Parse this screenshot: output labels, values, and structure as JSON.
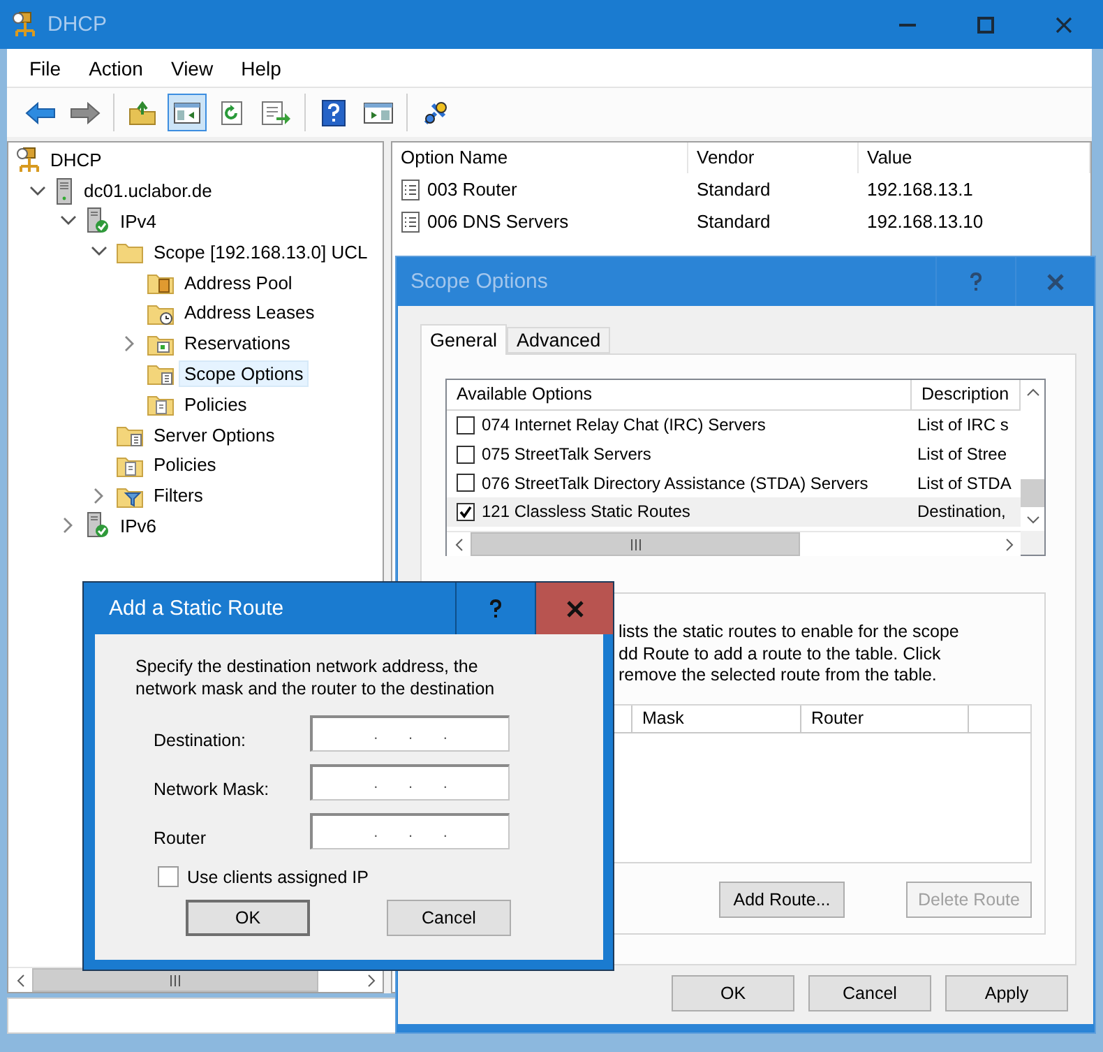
{
  "window": {
    "title": "DHCP"
  },
  "menu": [
    {
      "label": "File"
    },
    {
      "label": "Action"
    },
    {
      "label": "View"
    },
    {
      "label": "Help"
    }
  ],
  "toolbar": [
    [
      {
        "kind": "back",
        "pressed": false
      },
      {
        "kind": "forward",
        "pressed": false
      }
    ],
    [
      {
        "kind": "up",
        "pressed": false
      },
      {
        "kind": "console",
        "pressed": true
      },
      {
        "kind": "refresh",
        "pressed": false
      },
      {
        "kind": "export",
        "pressed": false
      }
    ],
    [
      {
        "kind": "help",
        "pressed": false
      },
      {
        "kind": "pane",
        "pressed": false
      }
    ],
    [
      {
        "kind": "tool",
        "pressed": false
      }
    ]
  ],
  "tree": [
    {
      "label": "DHCP",
      "kind": "root",
      "selected": false,
      "children": [
        {
          "label": "dc01.uclabor.de",
          "kind": "server",
          "expanded": true,
          "selected": false,
          "children": [
            {
              "label": "IPv4",
              "kind": "protocol",
              "expanded": true,
              "selected": false,
              "children": [
                {
                  "label": "Scope [192.168.13.0] UCL",
                  "kind": "folder",
                  "expanded": true,
                  "selected": false,
                  "children": [
                    {
                      "label": "Address Pool",
                      "kind": "pool",
                      "selected": false
                    },
                    {
                      "label": "Address Leases",
                      "kind": "leases",
                      "selected": false
                    },
                    {
                      "label": "Reservations",
                      "kind": "reservations",
                      "expanded": false,
                      "selected": false
                    },
                    {
                      "label": "Scope Options",
                      "kind": "options",
                      "selected": true
                    },
                    {
                      "label": "Policies",
                      "kind": "policies",
                      "selected": false
                    }
                  ]
                },
                {
                  "label": "Server Options",
                  "kind": "options",
                  "selected": false
                },
                {
                  "label": "Policies",
                  "kind": "policies",
                  "selected": false
                },
                {
                  "label": "Filters",
                  "kind": "filters",
                  "expanded": false,
                  "selected": false
                }
              ]
            },
            {
              "label": "IPv6",
              "kind": "protocol",
              "expanded": false,
              "selected": false
            }
          ]
        }
      ]
    }
  ],
  "options_table": {
    "columns": [
      "Option Name",
      "Vendor",
      "Value"
    ],
    "rows": [
      {
        "cells": [
          "003 Router",
          "Standard",
          "192.168.13.1"
        ]
      },
      {
        "cells": [
          "006 DNS Servers",
          "Standard",
          "192.168.13.10"
        ]
      }
    ]
  },
  "scope_dialog": {
    "title": "Scope Options",
    "active": false,
    "tabs": [
      {
        "label": "General",
        "selected": true
      },
      {
        "label": "Advanced",
        "selected": false
      }
    ],
    "options_list": {
      "columns": [
        "Available Options",
        "Description"
      ],
      "rows": [
        {
          "checked": false,
          "selected": false,
          "label": "074 Internet Relay Chat (IRC) Servers",
          "description": "List of IRC s"
        },
        {
          "checked": false,
          "selected": false,
          "label": "075 StreetTalk Servers",
          "description": "List of Stree"
        },
        {
          "checked": false,
          "selected": false,
          "label": "076 StreetTalk Directory Assistance (STDA) Servers",
          "description": "List of STDA"
        },
        {
          "checked": true,
          "selected": true,
          "label": "121 Classless Static Routes",
          "description": "Destination,"
        }
      ]
    },
    "routes": {
      "text_lines": [
        "lists the static routes to enable for the scope",
        "dd Route to add a route to the table.  Click",
        "remove the selected route from the table."
      ],
      "columns": [
        "Mask",
        "Router"
      ],
      "buttons": [
        {
          "label": "Add Route...",
          "disabled": false
        },
        {
          "label": "Delete Route",
          "disabled": true
        }
      ]
    },
    "buttons": [
      {
        "label": "OK"
      },
      {
        "label": "Cancel"
      },
      {
        "label": "Apply"
      }
    ]
  },
  "route_dialog": {
    "title": "Add a Static Route",
    "active": true,
    "description_lines": [
      "Specify the destination network address, the",
      "network mask and the router to the destination"
    ],
    "fields": [
      {
        "label": "Destination:",
        "separators": [
          ".",
          ".",
          "."
        ]
      },
      {
        "label": "Network Mask:",
        "separators": [
          ".",
          ".",
          "."
        ]
      },
      {
        "label": "Router",
        "separators": [
          ".",
          ".",
          "."
        ]
      }
    ],
    "checkbox": {
      "label": "Use clients assigned IP",
      "checked": false
    },
    "buttons": [
      {
        "label": "OK",
        "default": true
      },
      {
        "label": "Cancel",
        "default": false
      }
    ]
  }
}
